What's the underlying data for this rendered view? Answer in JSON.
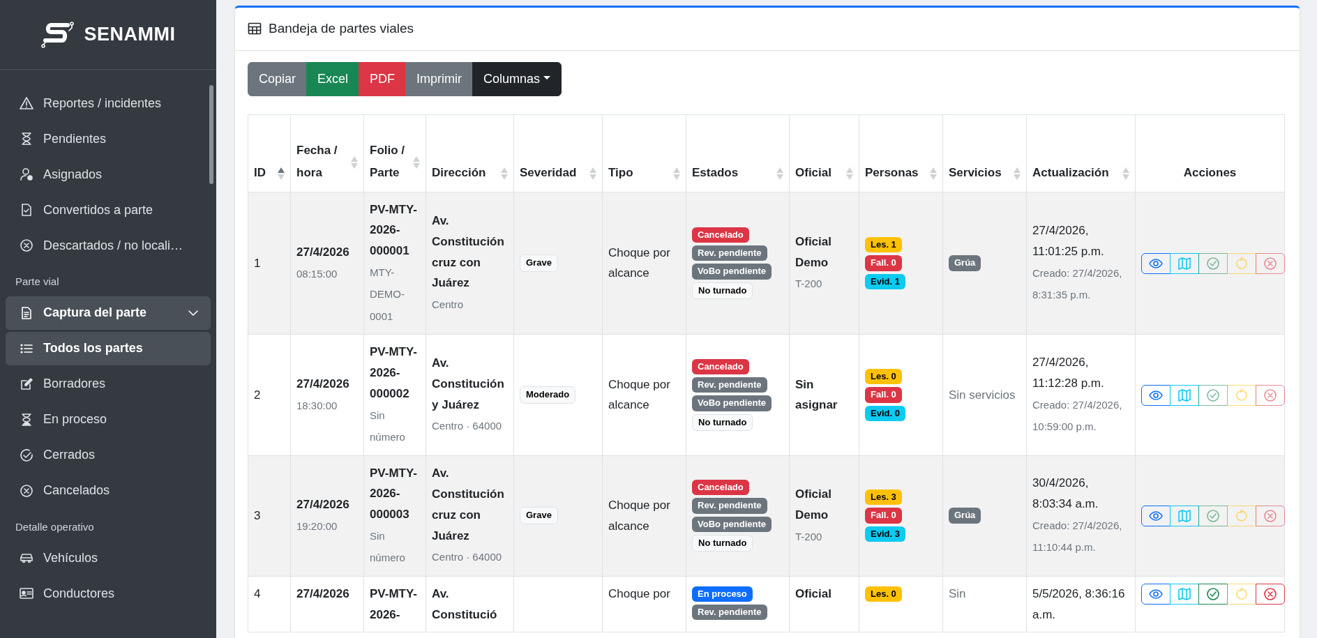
{
  "sidebar": {
    "brand": "SENAMMI",
    "sections": [
      {
        "items": [
          {
            "label": "Reportes / incidentes",
            "selected": false
          },
          {
            "label": "Pendientes",
            "selected": false
          },
          {
            "label": "Asignados",
            "selected": false
          },
          {
            "label": "Convertidos a parte",
            "selected": false
          },
          {
            "label": "Descartados / no locali…",
            "selected": false
          }
        ]
      },
      {
        "heading": "Parte vial",
        "items": [
          {
            "label": "Captura del parte",
            "expanded": true
          },
          {
            "label": "Todos los partes",
            "selected": true
          },
          {
            "label": "Borradores",
            "selected": false
          },
          {
            "label": "En proceso",
            "selected": false
          },
          {
            "label": "Cerrados",
            "selected": false
          },
          {
            "label": "Cancelados",
            "selected": false
          }
        ]
      },
      {
        "heading": "Detalle operativo",
        "items": [
          {
            "label": "Vehículos",
            "selected": false
          },
          {
            "label": "Conductores",
            "selected": false
          }
        ]
      }
    ]
  },
  "card": {
    "title": "Bandeja de partes viales",
    "toolbar": [
      {
        "label": "Copiar",
        "kind": "secondary"
      },
      {
        "label": "Excel",
        "kind": "success"
      },
      {
        "label": "PDF",
        "kind": "danger"
      },
      {
        "label": "Imprimir",
        "kind": "secondary"
      },
      {
        "label": "Columnas",
        "kind": "dropdown"
      }
    ],
    "table": {
      "columns": [
        {
          "label": "ID",
          "sorted": true
        },
        {
          "label": "Fecha / hora",
          "sorted": false
        },
        {
          "label": "Folio / Parte",
          "sorted": false
        },
        {
          "label": "Dirección",
          "sorted": false
        },
        {
          "label": "Severidad",
          "sorted": false
        },
        {
          "label": "Tipo",
          "sorted": false
        },
        {
          "label": "Estados",
          "sorted": false
        },
        {
          "label": "Oficial",
          "sorted": false
        },
        {
          "label": "Personas",
          "sorted": false
        },
        {
          "label": "Servicios",
          "sorted": false
        },
        {
          "label": "Actualización",
          "sorted": false
        },
        {
          "label": "Acciones"
        }
      ],
      "rows": [
        {
          "id": "1",
          "date": "27/4/2026",
          "time": "08:15:00",
          "folio": "PV-MTY-2026-000001",
          "folio_note": "MTY-DEMO-0001",
          "address": "Av. Constitución cruz con Juárez",
          "address_note": "Centro",
          "severity": "Grave",
          "type": "Choque por alcance",
          "states": [
            {
              "label": "Cancelado",
              "color": "#dc3545"
            },
            {
              "label": "Rev. pendiente",
              "color": "#6c757d"
            },
            {
              "label": "VoBo pendiente",
              "color": "#6c757d"
            },
            {
              "label": "No turnado",
              "color": "#f8f9fa"
            }
          ],
          "officer": "Oficial Demo",
          "officer_note": "T-200",
          "persons": [
            {
              "label": "Les. 1",
              "color": "#ffc107"
            },
            {
              "label": "Fall. 0",
              "color": "#dc3545"
            },
            {
              "label": "Evid. 1",
              "color": "#0dcaf0"
            }
          ],
          "services": [
            "Grúa"
          ],
          "updated": "27/4/2026, 11:01:25 p.m.",
          "created": "Creado: 27/4/2026, 8:31:35 p.m.",
          "actions": [
            {
              "disabled": false
            },
            {
              "disabled": false
            },
            {
              "disabled": true
            },
            {
              "disabled": true
            },
            {
              "disabled": true
            }
          ]
        },
        {
          "id": "2",
          "date": "27/4/2026",
          "time": "18:30:00",
          "folio": "PV-MTY-2026-000002",
          "folio_note": "Sin número",
          "address": "Av. Constitución y Juárez",
          "address_note": "Centro · 64000",
          "severity": "Moderado",
          "type": "Choque por alcance",
          "states": [
            {
              "label": "Cancelado",
              "color": "#dc3545"
            },
            {
              "label": "Rev. pendiente",
              "color": "#6c757d"
            },
            {
              "label": "VoBo pendiente",
              "color": "#6c757d"
            },
            {
              "label": "No turnado",
              "color": "#f8f9fa"
            }
          ],
          "officer": "Sin asignar",
          "persons": [
            {
              "label": "Les. 0",
              "color": "#ffc107"
            },
            {
              "label": "Fall. 0",
              "color": "#dc3545"
            },
            {
              "label": "Evid. 0",
              "color": "#0dcaf0"
            }
          ],
          "services_text": "Sin servicios",
          "updated": "27/4/2026, 11:12:28 p.m.",
          "created": "Creado: 27/4/2026, 10:59:00 p.m.",
          "actions": [
            {
              "disabled": false
            },
            {
              "disabled": false
            },
            {
              "disabled": true
            },
            {
              "disabled": true
            },
            {
              "disabled": true
            }
          ]
        },
        {
          "id": "3",
          "date": "27/4/2026",
          "time": "19:20:00",
          "folio": "PV-MTY-2026-000003",
          "folio_note": "Sin número",
          "address": "Av. Constitución cruz con Juárez",
          "address_note": "Centro · 64000",
          "severity": "Grave",
          "type": "Choque por alcance",
          "states": [
            {
              "label": "Cancelado",
              "color": "#dc3545"
            },
            {
              "label": "Rev. pendiente",
              "color": "#6c757d"
            },
            {
              "label": "VoBo pendiente",
              "color": "#6c757d"
            },
            {
              "label": "No turnado",
              "color": "#f8f9fa"
            }
          ],
          "officer": "Oficial Demo",
          "officer_note": "T-200",
          "persons": [
            {
              "label": "Les. 3",
              "color": "#ffc107"
            },
            {
              "label": "Fall. 0",
              "color": "#dc3545"
            },
            {
              "label": "Evid. 3",
              "color": "#0dcaf0"
            }
          ],
          "services": [
            "Grúa"
          ],
          "updated": "30/4/2026, 8:03:34 a.m.",
          "created": "Creado: 27/4/2026, 11:10:44 p.m.",
          "actions": [
            {
              "disabled": false
            },
            {
              "disabled": false
            },
            {
              "disabled": true
            },
            {
              "disabled": true
            },
            {
              "disabled": true
            }
          ]
        },
        {
          "id": "4",
          "date": "27/4/2026",
          "folio": "PV-MTY-2026-",
          "address": "Av. Constitució",
          "type": "Choque por",
          "states": [
            {
              "label": "En proceso",
              "color": "#0d6efd"
            },
            {
              "label": "Rev. pendiente",
              "color": "#6c757d"
            }
          ],
          "officer": "Oficial",
          "persons": [
            {
              "label": "Les. 0",
              "color": "#ffc107"
            }
          ],
          "services_text": "Sin",
          "updated": "5/5/2026, 8:36:16 a.m.",
          "actions": [
            {
              "disabled": false
            },
            {
              "disabled": false
            },
            {
              "disabled": false
            },
            {
              "disabled": true
            },
            {
              "disabled": false
            }
          ]
        }
      ]
    }
  }
}
